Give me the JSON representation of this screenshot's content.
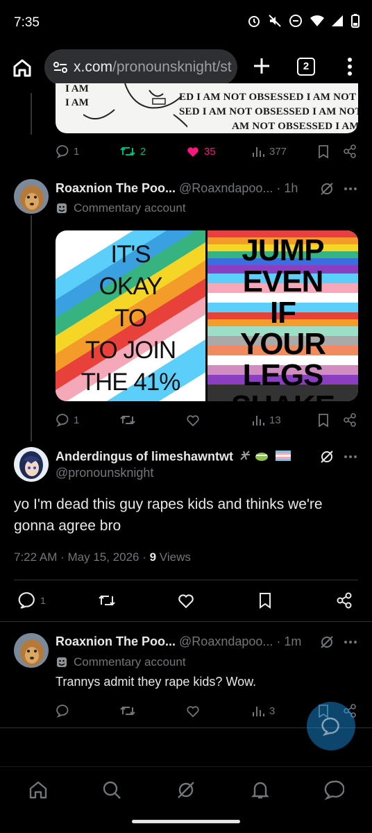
{
  "status": {
    "time": "7:35"
  },
  "browser": {
    "url_host": "x.com",
    "url_path": "/pronounsknight/st",
    "tab_count": "2"
  },
  "meme": {
    "lines": [
      "ED I AM NOT OBSESSED I AM NOT OBSE",
      "SED I AM NOT OBSESSED I AM NOT OBSE",
      "AM NOT OBSESSED I AM NOT OBSE"
    ],
    "left_lines": [
      "I AM",
      "I AM"
    ]
  },
  "tweet1_actions": {
    "replies": "1",
    "retweets": "2",
    "likes": "35",
    "views": "377"
  },
  "tweet2": {
    "name": "Roaxnion The Poo...",
    "handle": "@Roaxndapoo...",
    "time": "· 1h",
    "label": "Commentary account",
    "image_left_text": [
      "IT'S",
      "OKAY",
      "TO",
      "TO JOIN",
      "THE 41%"
    ],
    "image_right_text": [
      "JUMP",
      "EVEN",
      "IF",
      "YOUR",
      "LEGS",
      "SHAKE"
    ],
    "replies": "1",
    "views": "13"
  },
  "main_tweet": {
    "name": "Anderdingus of limeshawntwt",
    "handle": "@pronounsknight",
    "text": "yo I'm dead this guy rapes kids and thinks we're gonna agree bro",
    "timestamp": "7:22 AM · May 15, 2026 · ",
    "views_count": "9",
    "views_label": " Views",
    "replies": "1"
  },
  "reply": {
    "name": "Roaxnion The Poo...",
    "handle": "@Roaxndapoo...",
    "time": "· 1m",
    "label": "Commentary account",
    "text": "Trannys admit they rape kids?  Wow.",
    "views": "3"
  },
  "colors": {
    "like_pink": "#f91880",
    "retweet_green": "#00ba7c",
    "accent_blue": "#1d9bf0"
  }
}
